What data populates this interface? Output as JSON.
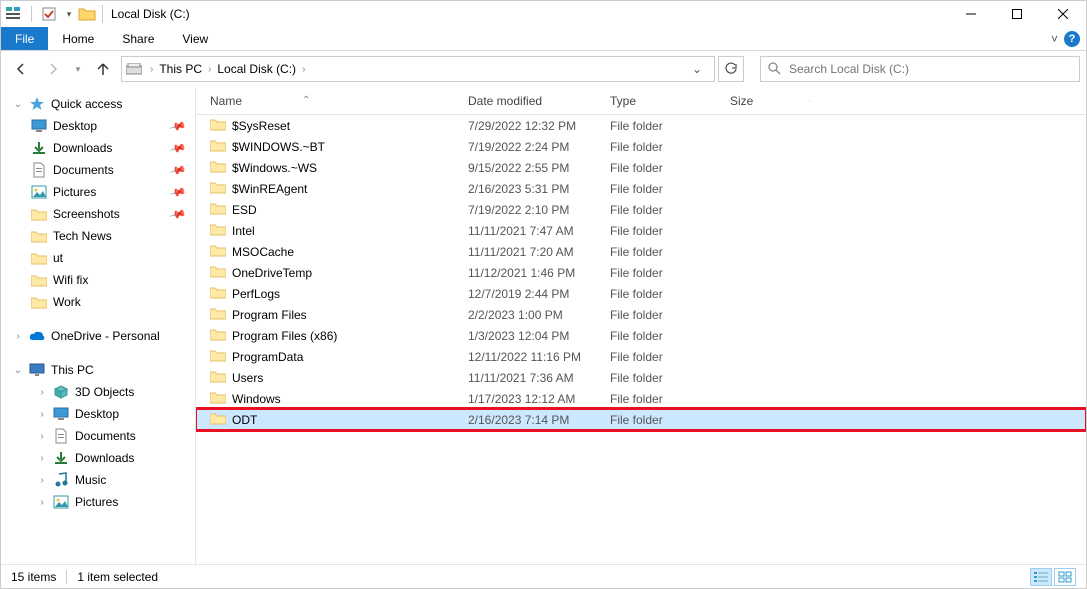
{
  "title": "Local Disk (C:)",
  "ribbon": {
    "file": "File",
    "tabs": [
      "Home",
      "Share",
      "View"
    ]
  },
  "breadcrumbs": [
    "This PC",
    "Local Disk (C:)"
  ],
  "search": {
    "placeholder": "Search Local Disk (C:)"
  },
  "columns": {
    "name": "Name",
    "date": "Date modified",
    "type": "Type",
    "size": "Size"
  },
  "sidebar": {
    "quick_access": {
      "label": "Quick access",
      "items": [
        {
          "label": "Desktop",
          "icon": "desktop",
          "pinned": true
        },
        {
          "label": "Downloads",
          "icon": "downloads",
          "pinned": true
        },
        {
          "label": "Documents",
          "icon": "documents",
          "pinned": true
        },
        {
          "label": "Pictures",
          "icon": "pictures",
          "pinned": true
        },
        {
          "label": "Screenshots",
          "icon": "folder",
          "pinned": true
        },
        {
          "label": "Tech News",
          "icon": "folder",
          "pinned": false
        },
        {
          "label": "ut",
          "icon": "folder",
          "pinned": false
        },
        {
          "label": "Wifi fix",
          "icon": "folder",
          "pinned": false
        },
        {
          "label": "Work",
          "icon": "folder",
          "pinned": false
        }
      ]
    },
    "onedrive": {
      "label": "OneDrive - Personal"
    },
    "this_pc": {
      "label": "This PC",
      "items": [
        {
          "label": "3D Objects",
          "icon": "3d"
        },
        {
          "label": "Desktop",
          "icon": "desktop"
        },
        {
          "label": "Documents",
          "icon": "documents"
        },
        {
          "label": "Downloads",
          "icon": "downloads"
        },
        {
          "label": "Music",
          "icon": "music"
        },
        {
          "label": "Pictures",
          "icon": "pictures"
        }
      ]
    }
  },
  "items": [
    {
      "name": "$SysReset",
      "date": "7/29/2022 12:32 PM",
      "type": "File folder",
      "selected": false
    },
    {
      "name": "$WINDOWS.~BT",
      "date": "7/19/2022 2:24 PM",
      "type": "File folder",
      "selected": false
    },
    {
      "name": "$Windows.~WS",
      "date": "9/15/2022 2:55 PM",
      "type": "File folder",
      "selected": false
    },
    {
      "name": "$WinREAgent",
      "date": "2/16/2023 5:31 PM",
      "type": "File folder",
      "selected": false
    },
    {
      "name": "ESD",
      "date": "7/19/2022 2:10 PM",
      "type": "File folder",
      "selected": false
    },
    {
      "name": "Intel",
      "date": "11/11/2021 7:47 AM",
      "type": "File folder",
      "selected": false
    },
    {
      "name": "MSOCache",
      "date": "11/11/2021 7:20 AM",
      "type": "File folder",
      "selected": false
    },
    {
      "name": "OneDriveTemp",
      "date": "11/12/2021 1:46 PM",
      "type": "File folder",
      "selected": false
    },
    {
      "name": "PerfLogs",
      "date": "12/7/2019 2:44 PM",
      "type": "File folder",
      "selected": false
    },
    {
      "name": "Program Files",
      "date": "2/2/2023 1:00 PM",
      "type": "File folder",
      "selected": false
    },
    {
      "name": "Program Files (x86)",
      "date": "1/3/2023 12:04 PM",
      "type": "File folder",
      "selected": false
    },
    {
      "name": "ProgramData",
      "date": "12/11/2022 11:16 PM",
      "type": "File folder",
      "selected": false
    },
    {
      "name": "Users",
      "date": "11/11/2021 7:36 AM",
      "type": "File folder",
      "selected": false
    },
    {
      "name": "Windows",
      "date": "1/17/2023 12:12 AM",
      "type": "File folder",
      "selected": false
    },
    {
      "name": "ODT",
      "date": "2/16/2023 7:14 PM",
      "type": "File folder",
      "selected": true
    }
  ],
  "status": {
    "items": "15 items",
    "selected": "1 item selected"
  }
}
